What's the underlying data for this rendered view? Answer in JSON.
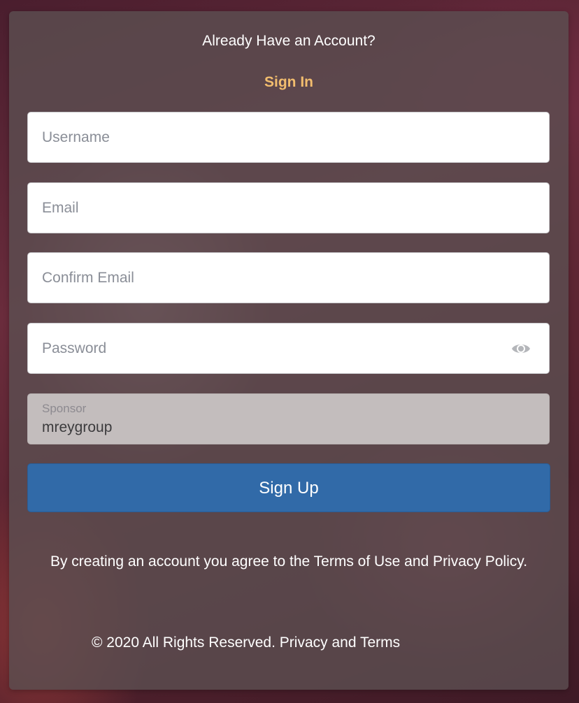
{
  "header": {
    "prompt_text": "Already Have an Account?",
    "sign_in_link": "Sign In"
  },
  "form": {
    "username": {
      "placeholder": "Username",
      "value": ""
    },
    "email": {
      "placeholder": "Email",
      "value": ""
    },
    "confirm_email": {
      "placeholder": "Confirm Email",
      "value": ""
    },
    "password": {
      "placeholder": "Password",
      "value": "",
      "toggle_icon": "eye-icon"
    },
    "sponsor": {
      "label": "Sponsor",
      "value": "mreygroup"
    },
    "submit_label": "Sign Up"
  },
  "footer": {
    "terms_prefix": "By creating an account you agree to the ",
    "terms_link": "Terms of Use and Privacy Policy.",
    "copyright_text": "© 2020 All Rights Reserved. ",
    "privacy_terms_link": "Privacy and Terms"
  },
  "colors": {
    "accent": "#f2bd6e",
    "button": "#316aa8",
    "card": "#5c4e50"
  }
}
